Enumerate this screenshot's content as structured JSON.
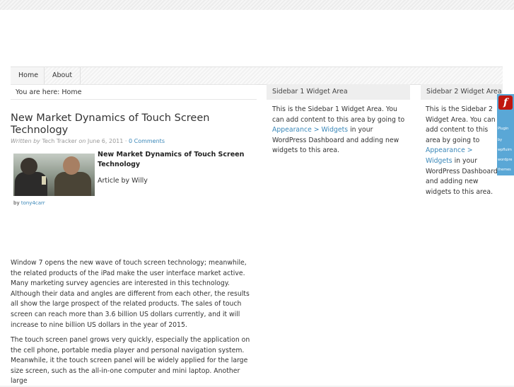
{
  "nav": {
    "items": [
      {
        "label": "Home"
      },
      {
        "label": "About"
      }
    ]
  },
  "breadcrumb": {
    "text": "You are here: Home"
  },
  "post": {
    "title": "New Market Dynamics of Touch Screen Technology",
    "meta": {
      "written_by": "Written",
      "by_word": "by",
      "author": "Tech Tracker",
      "on_word": "on",
      "date": "June 6, 2011",
      "separator": "·",
      "comments": "0 Comments"
    },
    "inner_title": "New Market Dynamics of Touch Screen Technology",
    "article_by": "Article by Willy",
    "byline_prefix": "by",
    "byline_author": "tony4carr",
    "paragraphs": [
      "Window 7 opens the new wave of touch screen technology; meanwhile, the related products of the iPad make the user interface market active. Many marketing survey agencies are interested in this technology. Although their data and angles are different from each other, the results all show the large prospect of the related products. The sales of touch screen can reach more than 3.6 billion US dollars currently, and it will increase to nine billion US dollars in the year of 2015.",
      "The touch screen panel grows very quickly, especially the application on the cell phone, portable media player and personal navigation system. Meanwhile, it the touch screen panel will be widely applied for the large size screen, such as the all-in-one computer and mini laptop. Another large"
    ]
  },
  "sidebar1": {
    "heading": "Sidebar 1 Widget Area",
    "text_before": "This is the Sidebar 1 Widget Area. You can add content to this area by going to",
    "link": "Appearance > Widgets",
    "text_after": "in your WordPress Dashboard and adding new widgets to this area."
  },
  "sidebar2": {
    "heading": "Sidebar 2 Widget Area",
    "text_before": "This is the Sidebar 2 Widget Area. You can add content to this area by going to",
    "link": "Appearance > Widgets",
    "text_after": "in your WordPress Dashboard and adding new widgets to this area."
  },
  "flash_widget": {
    "icon_glyph": "f",
    "lines": [
      "Plugin",
      "by",
      "wpfluim",
      "wordpre",
      "themes"
    ]
  },
  "colors": {
    "link": "#3a87b8",
    "flash_bg": "#5aa7d6",
    "flash_icon": "#c0170f"
  }
}
